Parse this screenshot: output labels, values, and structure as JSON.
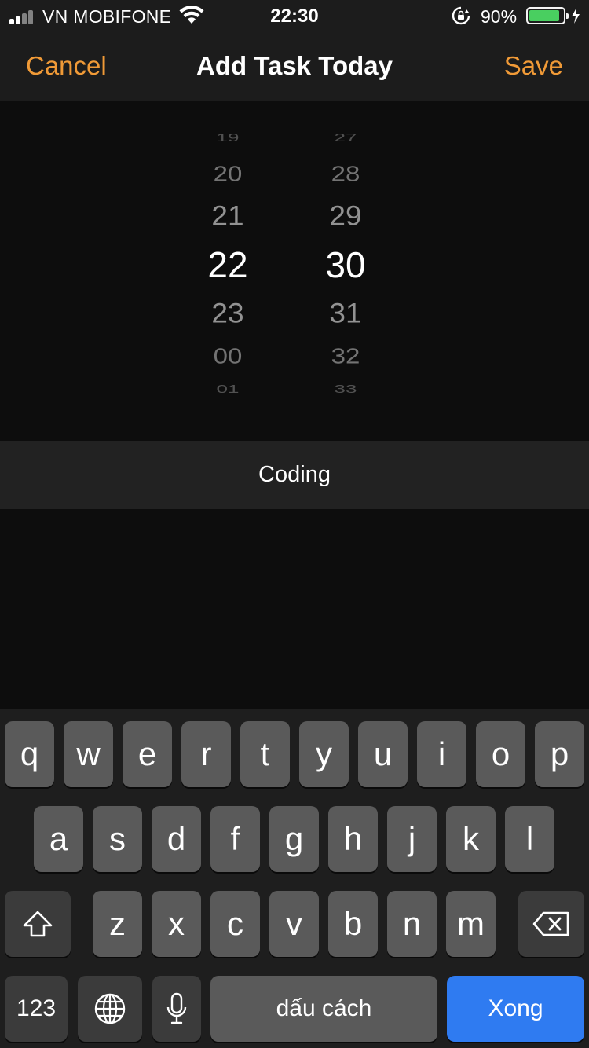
{
  "status_bar": {
    "carrier": "VN MOBIFONE",
    "time": "22:30",
    "battery_percent": "90%",
    "battery_level": 0.9,
    "battery_color": "#4cd964"
  },
  "nav": {
    "cancel_label": "Cancel",
    "title": "Add Task Today",
    "save_label": "Save",
    "accent_color": "#f09a37"
  },
  "picker": {
    "hours": {
      "items": [
        "19",
        "20",
        "21",
        "22",
        "23",
        "00",
        "01"
      ],
      "selected": "22"
    },
    "minutes": {
      "items": [
        "27",
        "28",
        "29",
        "30",
        "31",
        "32",
        "33"
      ],
      "selected": "30"
    }
  },
  "task": {
    "value": "Coding"
  },
  "keyboard": {
    "row1": [
      "q",
      "w",
      "e",
      "r",
      "t",
      "y",
      "u",
      "i",
      "o",
      "p"
    ],
    "row2": [
      "a",
      "s",
      "d",
      "f",
      "g",
      "h",
      "j",
      "k",
      "l"
    ],
    "row3": [
      "z",
      "x",
      "c",
      "v",
      "b",
      "n",
      "m"
    ],
    "numbers_label": "123",
    "space_label": "dấu cách",
    "return_label": "Xong",
    "shift_icon": "shift-icon",
    "delete_icon": "backspace-icon",
    "globe_icon": "globe-icon",
    "mic_icon": "microphone-icon"
  }
}
